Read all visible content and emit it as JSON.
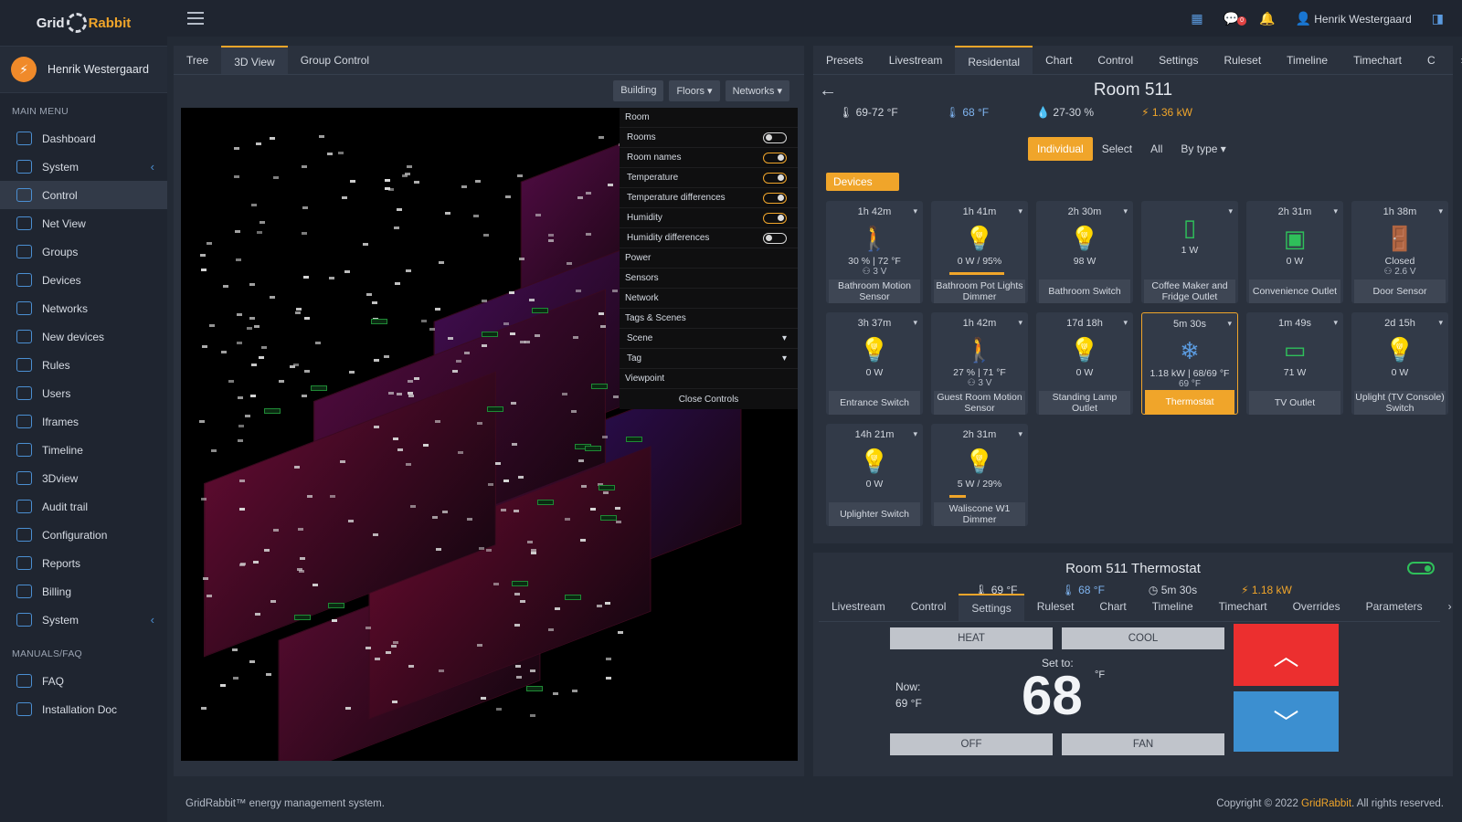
{
  "app": {
    "logo_left": "Grid",
    "logo_right": "Rabbit"
  },
  "user": {
    "name": "Henrik Westergaard",
    "avatar_initial": "⚡"
  },
  "sidebar": {
    "main_menu_title": "MAIN MENU",
    "items": [
      {
        "label": "Dashboard"
      },
      {
        "label": "System"
      },
      {
        "label": "Control"
      },
      {
        "label": "Net View"
      },
      {
        "label": "Groups"
      },
      {
        "label": "Devices"
      },
      {
        "label": "Networks"
      },
      {
        "label": "New devices"
      },
      {
        "label": "Rules"
      },
      {
        "label": "Users"
      },
      {
        "label": "Iframes"
      },
      {
        "label": "Timeline"
      },
      {
        "label": "3Dview"
      },
      {
        "label": "Audit trail"
      },
      {
        "label": "Configuration"
      },
      {
        "label": "Reports"
      },
      {
        "label": "Billing"
      },
      {
        "label": "System"
      }
    ],
    "manuals_title": "MANUALS/FAQ",
    "manuals": [
      {
        "label": "FAQ"
      },
      {
        "label": "Installation Doc"
      }
    ]
  },
  "topbar": {
    "user": "Henrik Westergaard",
    "message_count": "0"
  },
  "left_tabs": [
    "Tree",
    "3D View",
    "Group Control"
  ],
  "filters": [
    "Building",
    "Floors ▾",
    "Networks ▾"
  ],
  "controls": {
    "room_head": "Room",
    "toggles": [
      {
        "label": "Rooms",
        "on": false
      },
      {
        "label": "Room names",
        "on": true
      },
      {
        "label": "Temperature",
        "on": true
      },
      {
        "label": "Temperature differences",
        "on": true
      },
      {
        "label": "Humidity",
        "on": true
      },
      {
        "label": "Humidity differences",
        "on": false
      }
    ],
    "sections": [
      "Power",
      "Sensors",
      "Network",
      "Tags & Scenes"
    ],
    "scene": "Scene",
    "tag": "Tag",
    "viewpoint": "Viewpoint",
    "close": "Close Controls"
  },
  "right_tabs": [
    "Presets",
    "Livestream",
    "Residental",
    "Chart",
    "Control",
    "Settings",
    "Ruleset",
    "Timeline",
    "Timechart",
    "C"
  ],
  "room": {
    "title": "Room 511",
    "temp_range": "69-72 °F",
    "temp": "68 °F",
    "humidity": "27-30 %",
    "power": "1.36 kW"
  },
  "segment": [
    "Individual",
    "Select",
    "All",
    "By type ▾"
  ],
  "devices_label": "Devices",
  "devices": [
    {
      "time": "1h 42m",
      "icon": "🚶",
      "val": "30 % | 72 °F",
      "val2": "⚇ 3 V",
      "name": "Bathroom Motion Sensor"
    },
    {
      "time": "1h 41m",
      "icon": "💡",
      "val": "0 W / 95%",
      "val2": "",
      "name": "Bathroom Pot Lights Dimmer"
    },
    {
      "time": "2h 30m",
      "icon": "💡",
      "val": "98 W",
      "val2": "",
      "name": "Bathroom Switch"
    },
    {
      "time": "",
      "icon": "▯",
      "val": "1 W",
      "val2": "",
      "name": "Coffee Maker and Fridge Outlet"
    },
    {
      "time": "2h 31m",
      "icon": "▣",
      "val": "0 W",
      "val2": "",
      "name": "Convenience Outlet"
    },
    {
      "time": "1h 38m",
      "icon": "🚪",
      "val": "Closed",
      "val2": "⚇ 2.6 V",
      "name": "Door Sensor"
    },
    {
      "time": "3h 37m",
      "icon": "💡",
      "val": "0 W",
      "val2": "",
      "name": "Entrance Switch"
    },
    {
      "time": "1h 42m",
      "icon": "🚶",
      "val": "27 % | 71 °F",
      "val2": "⚇ 3 V",
      "name": "Guest Room Motion Sensor"
    },
    {
      "time": "17d 18h",
      "icon": "💡",
      "val": "0 W",
      "val2": "",
      "name": "Standing Lamp Outlet"
    },
    {
      "time": "5m 30s",
      "icon": "❄",
      "val": "1.18 kW | 68/69 °F",
      "val2": "69 °F",
      "name": "Thermostat"
    },
    {
      "time": "1m 49s",
      "icon": "▭",
      "val": "71 W",
      "val2": "",
      "name": "TV Outlet"
    },
    {
      "time": "2d 15h",
      "icon": "💡",
      "val": "0 W",
      "val2": "",
      "name": "Uplight (TV Console) Switch"
    },
    {
      "time": "14h 21m",
      "icon": "💡",
      "val": "0 W",
      "val2": "",
      "name": "Uplighter Switch"
    },
    {
      "time": "2h 31m",
      "icon": "💡",
      "val": "5 W / 29%",
      "val2": "",
      "name": "Waliscone W1 Dimmer"
    }
  ],
  "thermostat": {
    "title": "Room 511 Thermostat",
    "temp": "69 °F",
    "setpoint": "68 °F",
    "runtime": "5m 30s",
    "power": "1.18 kW",
    "tabs": [
      "Livestream",
      "Control",
      "Settings",
      "Ruleset",
      "Chart",
      "Timeline",
      "Timechart",
      "Overrides",
      "Parameters"
    ],
    "heat": "HEAT",
    "cool": "COOL",
    "off": "OFF",
    "fan": "FAN",
    "set_to": "Set to:",
    "now_label": "Now:",
    "now_value": "69 °F",
    "set_value": "68",
    "unit": "°F"
  },
  "footer": {
    "left": "GridRabbit™ energy management system.",
    "right_prefix": "Copyright © 2022 ",
    "brand": "GridRabbit",
    "right_suffix": ". All rights reserved."
  }
}
